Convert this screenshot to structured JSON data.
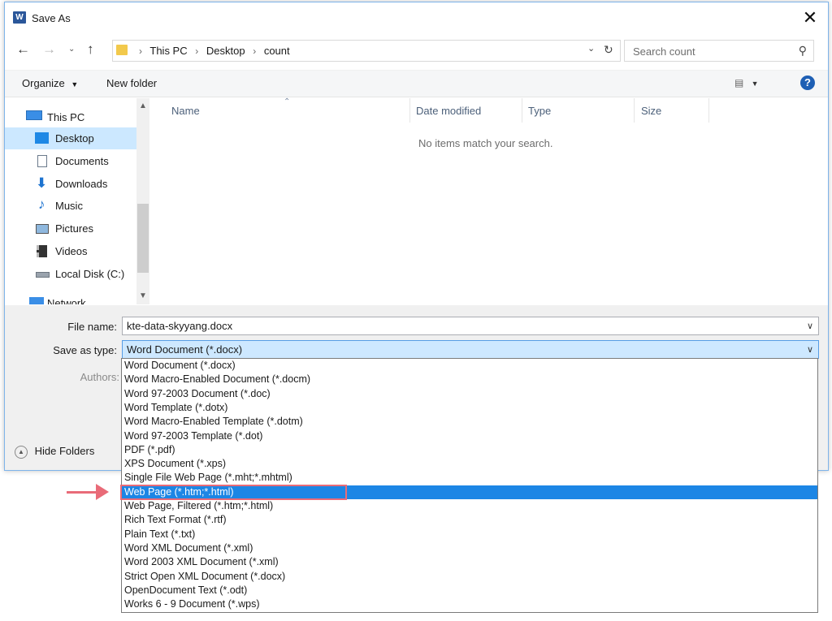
{
  "window": {
    "title": "Save As",
    "app_icon_text": "W"
  },
  "nav": {
    "breadcrumbs": [
      "This PC",
      "Desktop",
      "count"
    ],
    "search_placeholder": "Search count"
  },
  "toolbar": {
    "organize": "Organize",
    "new_folder": "New folder"
  },
  "sidebar": {
    "items": [
      {
        "label": "This PC",
        "icon": "computer-icon"
      },
      {
        "label": "Desktop",
        "icon": "desktop-icon",
        "selected": true
      },
      {
        "label": "Documents",
        "icon": "documents-icon"
      },
      {
        "label": "Downloads",
        "icon": "download-arrow-icon"
      },
      {
        "label": "Music",
        "icon": "music-note-icon"
      },
      {
        "label": "Pictures",
        "icon": "pictures-icon"
      },
      {
        "label": "Videos",
        "icon": "film-icon"
      },
      {
        "label": "Local Disk (C:)",
        "icon": "disk-drive-icon"
      },
      {
        "label": "Network",
        "icon": "network-icon"
      }
    ]
  },
  "content": {
    "columns": [
      "Name",
      "Date modified",
      "Type",
      "Size"
    ],
    "empty_message": "No items match your search."
  },
  "form": {
    "file_name_label": "File name:",
    "file_name_value": "kte-data-skyyang.docx",
    "save_type_label": "Save as type:",
    "save_type_value": "Word Document (*.docx)",
    "authors_label": "Authors:",
    "hide_folders": "Hide Folders"
  },
  "dropdown": {
    "highlighted_index": 9,
    "options": [
      "Word Document (*.docx)",
      "Word Macro-Enabled Document (*.docm)",
      "Word 97-2003 Document (*.doc)",
      "Word Template (*.dotx)",
      "Word Macro-Enabled Template (*.dotm)",
      "Word 97-2003 Template (*.dot)",
      "PDF (*.pdf)",
      "XPS Document (*.xps)",
      "Single File Web Page (*.mht;*.mhtml)",
      "Web Page (*.htm;*.html)",
      "Web Page, Filtered (*.htm;*.html)",
      "Rich Text Format (*.rtf)",
      "Plain Text (*.txt)",
      "Word XML Document (*.xml)",
      "Word 2003 XML Document (*.xml)",
      "Strict Open XML Document (*.docx)",
      "OpenDocument Text (*.odt)",
      "Works 6 - 9 Document (*.wps)"
    ]
  },
  "colors": {
    "selection_blue": "#1c86e5",
    "annotation_red": "#e96b78",
    "sidebar_selected": "#cce8ff"
  }
}
